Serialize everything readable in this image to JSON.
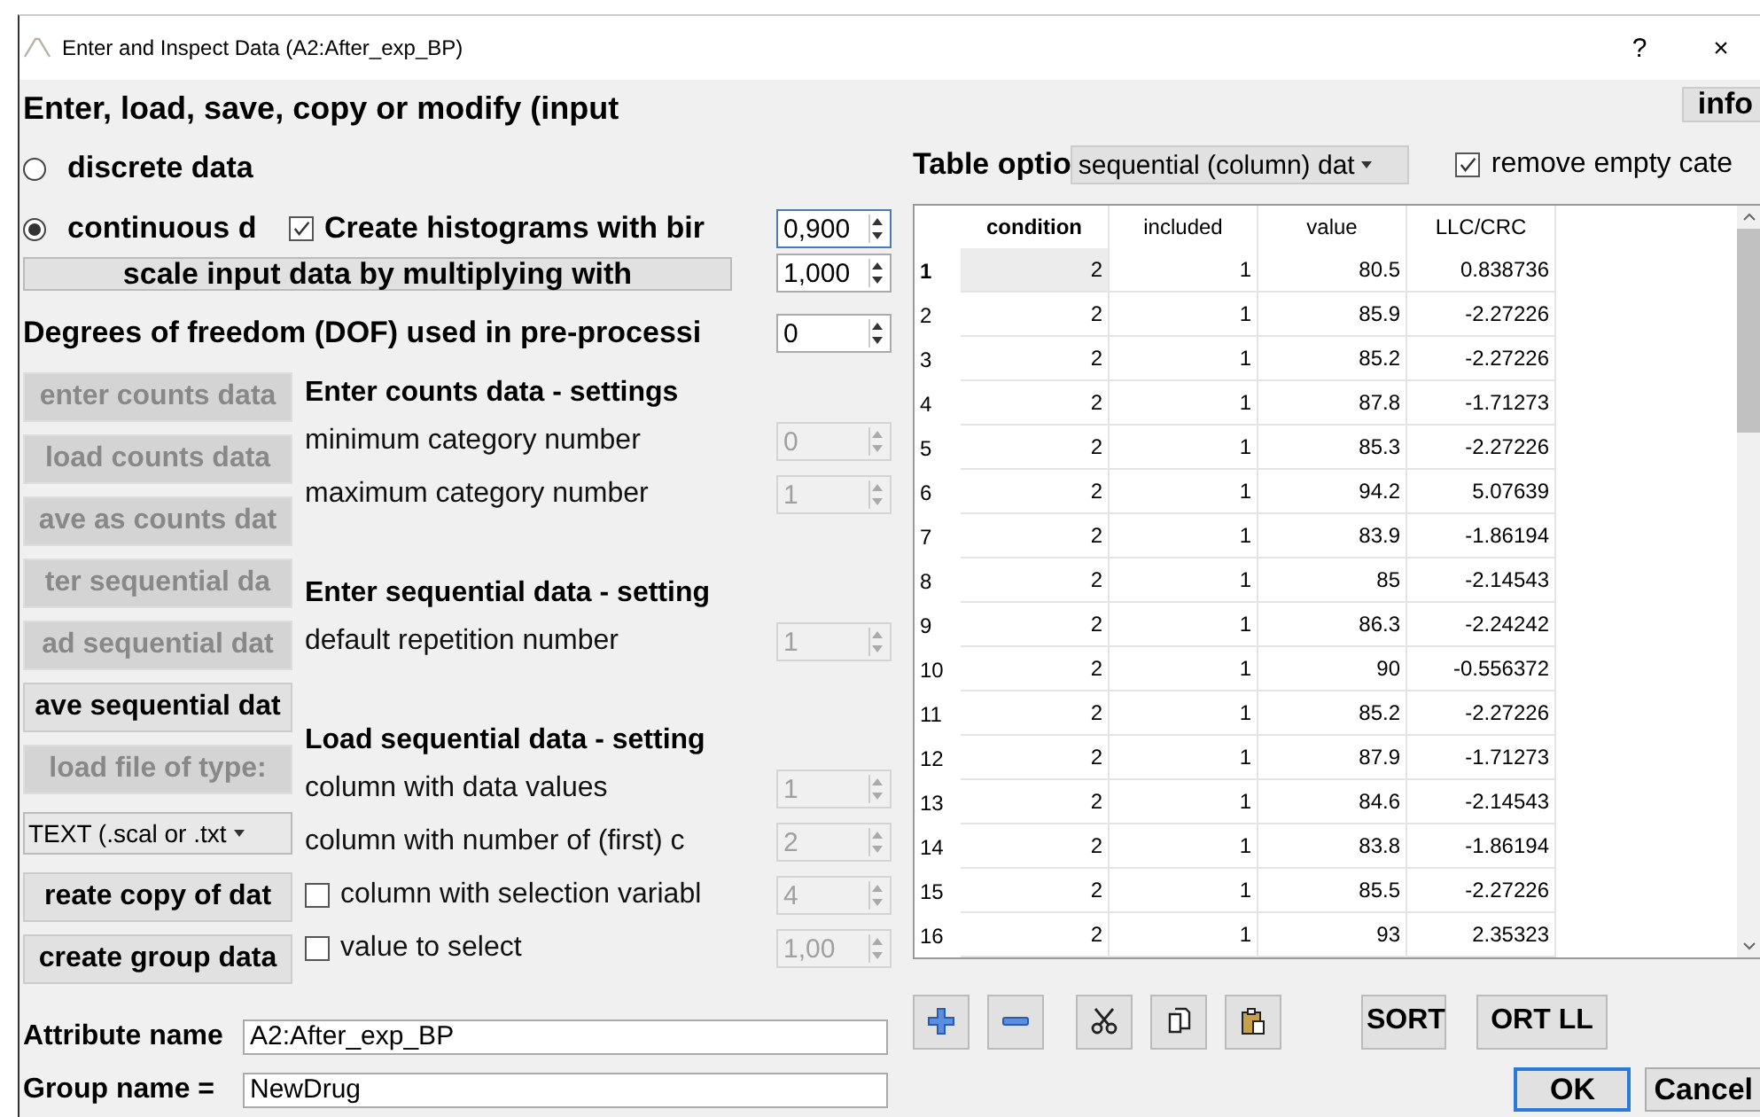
{
  "window": {
    "title": "Enter and Inspect Data (A2:After_exp_BP)",
    "buttons": [
      "?",
      "×"
    ]
  },
  "heading": "Enter,  load,  save,  copy  or modify (input",
  "info_button": "info",
  "data_type": [
    {
      "label": "discrete data",
      "selected": false
    },
    {
      "label": "continuous d",
      "selected": true
    }
  ],
  "histogram": {
    "label": "Create histograms with bir",
    "checked": true,
    "value": "0,900"
  },
  "scale": {
    "label": "scale input data by multiplying with",
    "value": "1,000"
  },
  "dof": {
    "label": "Degrees of freedom (DOF) used in pre-processi",
    "value": "0"
  },
  "actions": [
    {
      "kind": "button",
      "label": "enter counts data",
      "disabled": true
    },
    {
      "kind": "button",
      "label": "load counts data",
      "disabled": true
    },
    {
      "kind": "button",
      "label": "ave as counts dat",
      "disabled": true
    },
    {
      "kind": "button",
      "label": "ter sequential da",
      "disabled": true
    },
    {
      "kind": "button",
      "label": "ad sequential dat",
      "disabled": true
    },
    {
      "kind": "button",
      "label": "ave sequential dat",
      "disabled": false
    },
    {
      "kind": "button",
      "label": "load file of type:",
      "disabled": true
    },
    {
      "kind": "dropdown",
      "label": "TEXT (.scal or .txt",
      "disabled": false
    },
    {
      "kind": "button",
      "label": "reate copy of dat",
      "disabled": false
    },
    {
      "kind": "button",
      "label": "create group data",
      "disabled": false
    }
  ],
  "settings": [
    {
      "kind": "heading",
      "label": "Enter counts data - settings"
    },
    {
      "kind": "spin",
      "label": "minimum category number",
      "value": "0",
      "disabled": true
    },
    {
      "kind": "spin",
      "label": "maximum category number",
      "value": "1",
      "disabled": true
    },
    {
      "kind": "heading",
      "label": "Enter sequential data - setting"
    },
    {
      "kind": "spin",
      "label": "default repetition number",
      "value": "1",
      "disabled": true
    },
    {
      "kind": "heading",
      "label": "Load sequential data - setting"
    },
    {
      "kind": "spin",
      "label": "column with data values",
      "value": "1",
      "disabled": true
    },
    {
      "kind": "spin",
      "label": "column with number of (first) c",
      "value": "2",
      "disabled": true
    },
    {
      "kind": "check_spin",
      "label": "column with selection variabl",
      "checked": false,
      "value": "4",
      "disabled": true
    },
    {
      "kind": "check_spin",
      "label": "value to select",
      "checked": false,
      "value": "1,00",
      "disabled": true
    }
  ],
  "attribute_name": {
    "label": "Attribute name",
    "value": "A2:After_exp_BP"
  },
  "group_name": {
    "label": "Group name =",
    "value": "NewDrug"
  },
  "table_options": {
    "label": "Table optio",
    "dropdown": "sequential (column) dat",
    "remove_empty": {
      "label": "remove empty cate",
      "checked": true
    }
  },
  "table": {
    "columns": [
      {
        "label": "condition",
        "selected": true
      },
      {
        "label": "included",
        "selected": false
      },
      {
        "label": "value",
        "selected": false
      },
      {
        "label": "LLC/CRC",
        "selected": false
      }
    ],
    "rows": [
      {
        "number": "1",
        "selected": true,
        "cells": [
          "2",
          "1",
          "80.5",
          "0.838736"
        ]
      },
      {
        "number": "2",
        "selected": false,
        "cells": [
          "2",
          "1",
          "85.9",
          "-2.27226"
        ]
      },
      {
        "number": "3",
        "selected": false,
        "cells": [
          "2",
          "1",
          "85.2",
          "-2.27226"
        ]
      },
      {
        "number": "4",
        "selected": false,
        "cells": [
          "2",
          "1",
          "87.8",
          "-1.71273"
        ]
      },
      {
        "number": "5",
        "selected": false,
        "cells": [
          "2",
          "1",
          "85.3",
          "-2.27226"
        ]
      },
      {
        "number": "6",
        "selected": false,
        "cells": [
          "2",
          "1",
          "94.2",
          "5.07639"
        ]
      },
      {
        "number": "7",
        "selected": false,
        "cells": [
          "2",
          "1",
          "83.9",
          "-1.86194"
        ]
      },
      {
        "number": "8",
        "selected": false,
        "cells": [
          "2",
          "1",
          "85",
          "-2.14543"
        ]
      },
      {
        "number": "9",
        "selected": false,
        "cells": [
          "2",
          "1",
          "86.3",
          "-2.24242"
        ]
      },
      {
        "number": "10",
        "selected": false,
        "cells": [
          "2",
          "1",
          "90",
          "-0.556372"
        ]
      },
      {
        "number": "11",
        "selected": false,
        "cells": [
          "2",
          "1",
          "85.2",
          "-2.27226"
        ]
      },
      {
        "number": "12",
        "selected": false,
        "cells": [
          "2",
          "1",
          "87.9",
          "-1.71273"
        ]
      },
      {
        "number": "13",
        "selected": false,
        "cells": [
          "2",
          "1",
          "84.6",
          "-2.14543"
        ]
      },
      {
        "number": "14",
        "selected": false,
        "cells": [
          "2",
          "1",
          "83.8",
          "-1.86194"
        ]
      },
      {
        "number": "15",
        "selected": false,
        "cells": [
          "2",
          "1",
          "85.5",
          "-2.27226"
        ]
      },
      {
        "number": "16",
        "selected": false,
        "cells": [
          "2",
          "1",
          "93",
          "2.35323"
        ]
      }
    ]
  },
  "sort_buttons": [
    "SORT",
    "ORT LL"
  ],
  "dialog_buttons": [
    {
      "label": "OK",
      "default": true
    },
    {
      "label": "Cancel",
      "default": false
    }
  ]
}
